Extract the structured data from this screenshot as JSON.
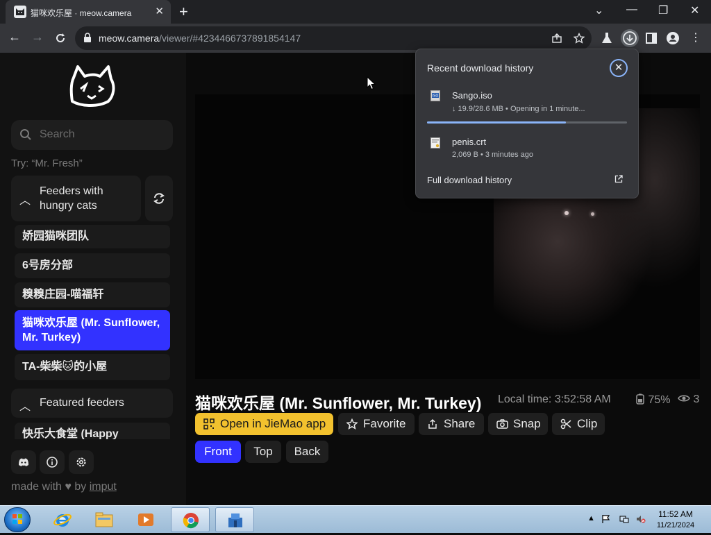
{
  "browser": {
    "tab_title": "猫咪欢乐屋 · meow.camera",
    "tab_close": "✕",
    "new_tab": "+",
    "url_host": "meow.camera",
    "url_path": "/viewer/#4234466737891854147",
    "window_controls": {
      "minimize": "—",
      "maximize": "❐",
      "close": "✕",
      "tab_search": "⌄"
    }
  },
  "sidebar": {
    "search_placeholder": "Search",
    "try_text": "Try: “Mr. Fresh”",
    "feeders_section": "Feeders with hungry cats",
    "feeders": [
      {
        "label": "娇园猫咪团队"
      },
      {
        "label": "6号房分部"
      },
      {
        "label": "糗糗庄园-喵福轩"
      },
      {
        "label": "猫咪欢乐屋 (Mr. Sunflower, Mr. Turkey)"
      },
      {
        "label": "TA-柴柴🐱的小屋"
      }
    ],
    "featured_section": "Featured feeders",
    "featured_first": "快乐大食堂 (Happy",
    "made_with": "made with",
    "by": "by",
    "author": "imput"
  },
  "camera": {
    "title": "猫咪欢乐屋 (Mr. Sunflower, Mr. Turkey)",
    "local_time": "Local time: 3:52:58 AM",
    "battery": "75%",
    "viewers": "3"
  },
  "actions": {
    "open_app": "Open in JieMao app",
    "favorite": "Favorite",
    "share": "Share",
    "snap": "Snap",
    "clip": "Clip"
  },
  "views": {
    "front": "Front",
    "top": "Top",
    "back": "Back"
  },
  "downloads": {
    "heading": "Recent download history",
    "items": [
      {
        "name": "Sango.iso",
        "meta": "↓ 19.9/28.6 MB • Opening in 1 minute..."
      },
      {
        "name": "penis.crt",
        "meta": "2,069 B • 3 minutes ago"
      }
    ],
    "progress_fraction": 0.696,
    "full_history": "Full download history"
  },
  "taskbar": {
    "time": "11:52 AM",
    "date": "11/21/2024"
  },
  "colors": {
    "accent_blue": "#3232ff",
    "open_app_yellow": "#f2c12e",
    "progress_blue": "#8ab4f8"
  }
}
